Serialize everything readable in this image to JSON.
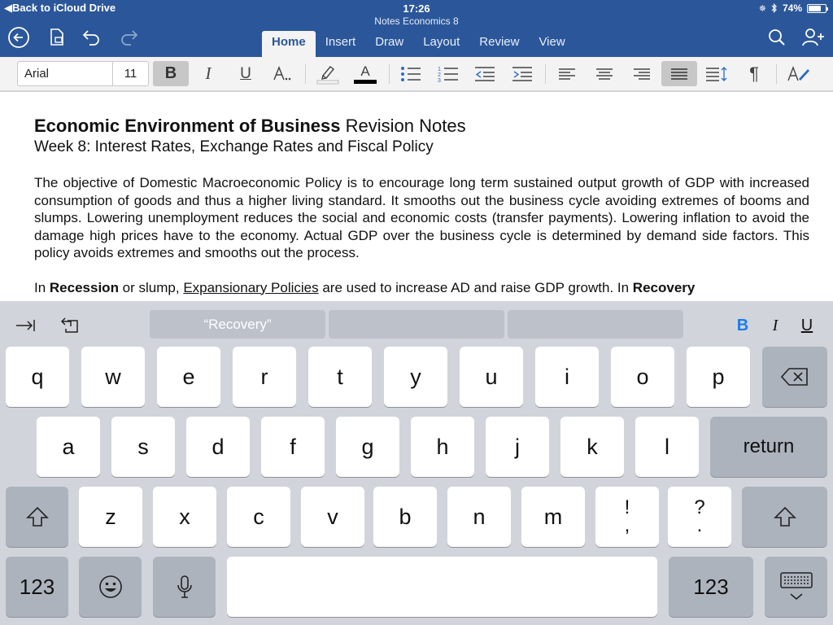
{
  "status": {
    "back_label": "Back to iCloud Drive",
    "time": "17:26",
    "battery": "74%",
    "battery_level": 0.74
  },
  "document_title": "Notes Economics 8",
  "tabs": [
    {
      "label": "Home"
    },
    {
      "label": "Insert"
    },
    {
      "label": "Draw"
    },
    {
      "label": "Layout"
    },
    {
      "label": "Review"
    },
    {
      "label": "View"
    }
  ],
  "ribbon": {
    "font_name": "Arial",
    "font_size": "11",
    "bold_label": "B",
    "italic_label": "I",
    "underline_label": "U",
    "font_color_label": "A",
    "font_color": "#000000"
  },
  "doc": {
    "title_bold": "Economic Environment of Business",
    "title_rest": " Revision Notes",
    "subtitle": "Week 8: Interest Rates, Exchange Rates and Fiscal Policy",
    "paragraph1": "The objective of Domestic Macroeconomic Policy is to encourage long term sustained output growth of GDP with increased consumption of goods and thus a higher living standard. It smooths out the business cycle avoiding extremes of booms and slumps. Lowering unemployment reduces the social and economic costs (transfer payments). Lowering inflation to avoid the damage high prices have to the economy. Actual GDP over the business cycle is determined by demand side factors. This policy avoids extremes and smooths out the process.",
    "p2_a": "In ",
    "p2_b": "Recession",
    "p2_c": " or slump, ",
    "p2_d": "Expansionary Policies",
    "p2_e": " are used to increase AD and raise GDP growth. In ",
    "p2_f": "Recovery"
  },
  "keyboard": {
    "suggestions": [
      "“Recovery”",
      "",
      ""
    ],
    "format_bold": "B",
    "format_italic": "I",
    "format_underline": "U",
    "row1": [
      "q",
      "w",
      "e",
      "r",
      "t",
      "y",
      "u",
      "i",
      "o",
      "p"
    ],
    "row2": [
      "a",
      "s",
      "d",
      "f",
      "g",
      "h",
      "j",
      "k",
      "l"
    ],
    "row3": [
      "z",
      "x",
      "c",
      "v",
      "b",
      "n",
      "m"
    ],
    "excl_top": "!",
    "excl_bottom": ",",
    "q_top": "?",
    "q_bottom": ".",
    "return_label": "return",
    "numbers_label": "123",
    "accent": "#2b579a"
  }
}
